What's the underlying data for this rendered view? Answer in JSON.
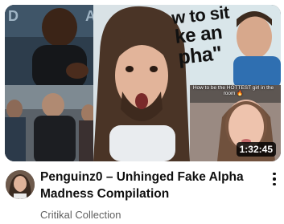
{
  "thumbnail": {
    "overlay_line1": "w to sit",
    "overlay_line2": "ke an",
    "overlay_line3": "pha\"",
    "caption": "How to be the HOTTEST girl in the room 🔥",
    "duration": "1:32:45"
  },
  "video": {
    "title": "Penguinz0 – Unhinged Fake Alpha Madness Compilation",
    "channel": "Critikal Collection"
  },
  "icons": {
    "more": "more-vert-icon"
  }
}
